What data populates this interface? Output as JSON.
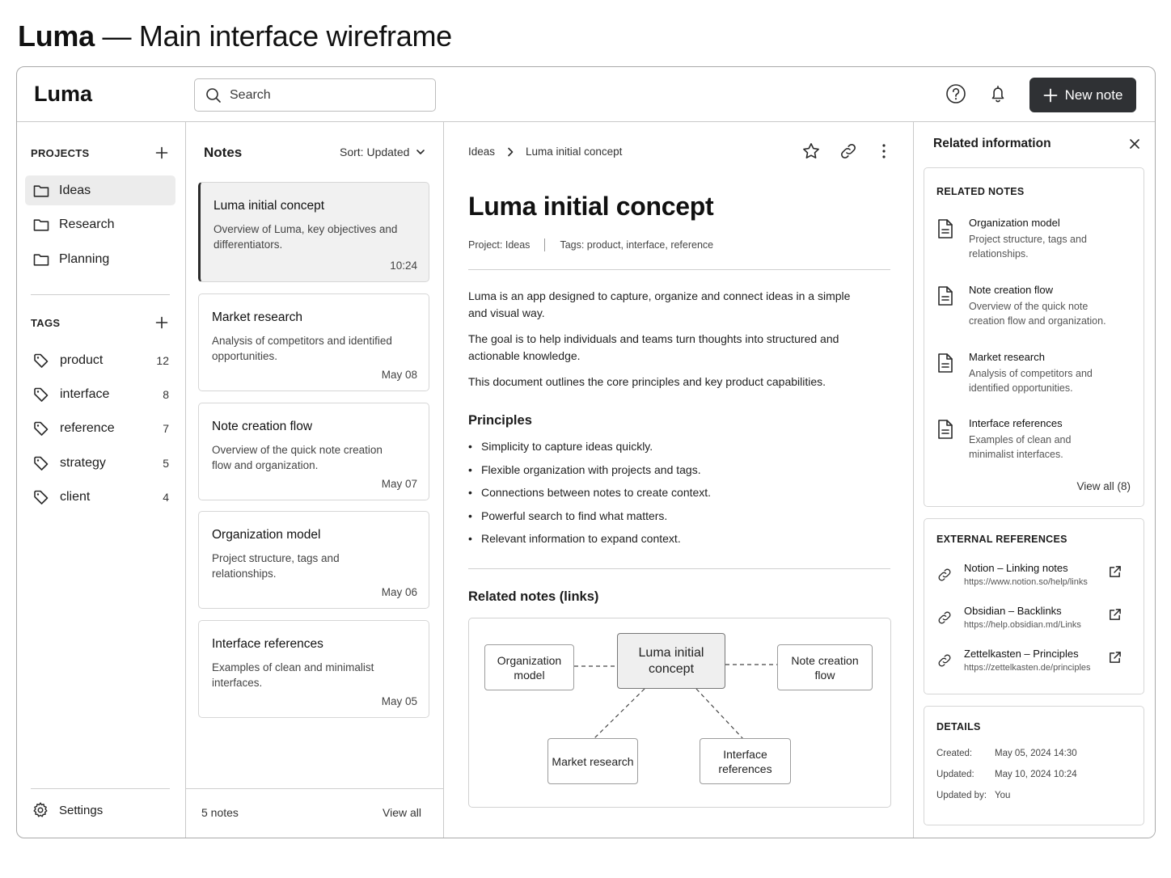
{
  "page": {
    "heading_bold": "Luma",
    "heading_rest": " — Main interface wireframe"
  },
  "app": {
    "logo": "Luma",
    "search_placeholder": "Search",
    "new_note_label": "New note",
    "icons": {
      "help": "help-circle-icon",
      "bell": "bell-icon",
      "plus": "plus-icon",
      "search": "search-icon"
    }
  },
  "sidebar": {
    "projects_label": "PROJECTS",
    "projects": [
      {
        "label": "Ideas",
        "active": true
      },
      {
        "label": "Research",
        "active": false
      },
      {
        "label": "Planning",
        "active": false
      }
    ],
    "tags_label": "TAGS",
    "tags": [
      {
        "label": "product",
        "count": "12"
      },
      {
        "label": "interface",
        "count": "8"
      },
      {
        "label": "reference",
        "count": "7"
      },
      {
        "label": "strategy",
        "count": "5"
      },
      {
        "label": "client",
        "count": "4"
      }
    ],
    "settings_label": "Settings"
  },
  "notes": {
    "title": "Notes",
    "sort_label": "Sort: Updated",
    "items": [
      {
        "title": "Luma initial concept",
        "desc": "Overview of Luma, key objectives and differentiators.",
        "time": "10:24",
        "active": true
      },
      {
        "title": "Market research",
        "desc": "Analysis of competitors and identified opportunities.",
        "time": "May 08",
        "active": false
      },
      {
        "title": "Note creation flow",
        "desc": "Overview of the quick note creation flow and organization.",
        "time": "May 07",
        "active": false
      },
      {
        "title": "Organization model",
        "desc": "Project structure, tags and relationships.",
        "time": "May 06",
        "active": false
      },
      {
        "title": "Interface references",
        "desc": "Examples of clean and minimalist interfaces.",
        "time": "May 05",
        "active": false
      }
    ],
    "count_label": "5 notes",
    "view_all_label": "View all"
  },
  "document": {
    "breadcrumb": [
      "Ideas",
      "Luma initial concept"
    ],
    "title": "Luma initial concept",
    "meta_project": "Project: Ideas",
    "meta_tags": "Tags: product, interface, reference",
    "paragraphs": [
      "Luma is an app designed to capture, organize and connect ideas in a simple and visual way.",
      "The goal is to help individuals and teams turn thoughts into structured and actionable knowledge.",
      "This document outlines the core principles and key product capabilities."
    ],
    "principles_heading": "Principles",
    "principles": [
      "Simplicity to capture ideas quickly.",
      "Flexible organization with projects and tags.",
      "Connections between notes to create context.",
      "Powerful search to find what matters.",
      "Relevant information to expand context."
    ],
    "related_heading": "Related notes (links)",
    "graph": {
      "center": "Luma initial concept",
      "left": "Organization model",
      "right": "Note creation flow",
      "bottom_left": "Market research",
      "bottom_right": "Interface references"
    },
    "icons": {
      "star": "star-icon",
      "link": "link-icon",
      "more": "more-vertical-icon"
    }
  },
  "right_panel": {
    "title": "Related information",
    "related_notes_label": "RELATED NOTES",
    "related_notes": [
      {
        "title": "Organization model",
        "desc": "Project structure, tags and relationships."
      },
      {
        "title": "Note creation flow",
        "desc": "Overview of the quick note creation flow and organization."
      },
      {
        "title": "Market research",
        "desc": "Analysis of competitors and identified opportunities."
      },
      {
        "title": "Interface references",
        "desc": "Examples of clean and minimalist interfaces."
      }
    ],
    "view_all_label": "View all (8)",
    "external_label": "EXTERNAL REFERENCES",
    "external": [
      {
        "title": "Notion – Linking notes",
        "url": "https://www.notion.so/help/links"
      },
      {
        "title": "Obsidian – Backlinks",
        "url": "https://help.obsidian.md/Links"
      },
      {
        "title": "Zettelkasten – Principles",
        "url": "https://zettelkasten.de/principles"
      }
    ],
    "details_label": "DETAILS",
    "details": [
      {
        "key": "Created:",
        "value": "May 05, 2024 14:30"
      },
      {
        "key": "Updated:",
        "value": "May 10, 2024 10:24"
      },
      {
        "key": "Updated by:",
        "value": "You"
      }
    ]
  }
}
